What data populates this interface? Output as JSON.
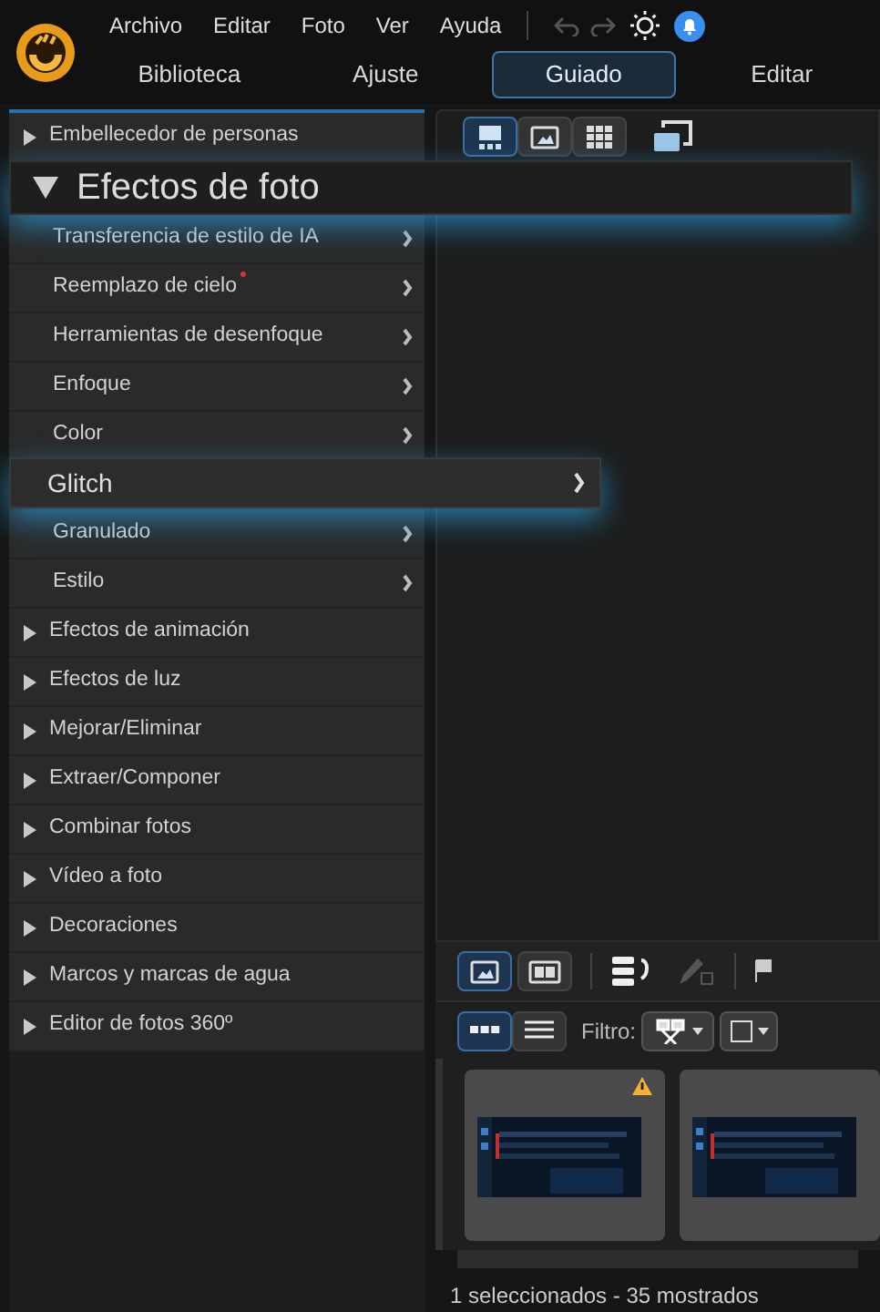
{
  "menu": [
    {
      "label": "Archivo"
    },
    {
      "label": "Editar"
    },
    {
      "label": "Foto"
    },
    {
      "label": "Ver"
    },
    {
      "label": "Ayuda"
    }
  ],
  "tabs": [
    {
      "label": "Biblioteca",
      "selected": false
    },
    {
      "label": "Ajuste",
      "selected": false
    },
    {
      "label": "Guiado",
      "selected": true
    },
    {
      "label": "Editar",
      "selected": false
    }
  ],
  "panel": {
    "items": [
      {
        "label": "Embellecedor de personas",
        "expanded": false
      },
      {
        "label": "Efectos de foto",
        "expanded": true,
        "children": [
          {
            "label": "Transferencia de estilo de IA",
            "new": false,
            "selected": false
          },
          {
            "label": "Reemplazo de cielo",
            "new": true,
            "selected": false
          },
          {
            "label": "Herramientas de desenfoque",
            "new": false,
            "selected": false
          },
          {
            "label": "Enfoque",
            "new": false,
            "selected": false
          },
          {
            "label": "Color",
            "new": false,
            "selected": false
          },
          {
            "label": "Glitch",
            "new": false,
            "selected": true
          },
          {
            "label": "Granulado",
            "new": false,
            "selected": false
          },
          {
            "label": "Estilo",
            "new": false,
            "selected": false
          }
        ]
      },
      {
        "label": "Efectos de animación",
        "expanded": false
      },
      {
        "label": "Efectos de luz",
        "expanded": false
      },
      {
        "label": "Mejorar/Eliminar",
        "expanded": false
      },
      {
        "label": "Extraer/Componer",
        "expanded": false
      },
      {
        "label": "Combinar fotos",
        "expanded": false
      },
      {
        "label": "Vídeo a foto",
        "expanded": false
      },
      {
        "label": "Decoraciones",
        "expanded": false
      },
      {
        "label": "Marcos y marcas de agua",
        "expanded": false
      },
      {
        "label": "Editor de fotos 360º",
        "expanded": false
      }
    ]
  },
  "view_buttons": [
    {
      "kind": "filmstrip",
      "selected": true
    },
    {
      "kind": "single",
      "selected": false
    },
    {
      "kind": "grid",
      "selected": false
    }
  ],
  "layout_buttons": [
    {
      "kind": "single",
      "selected": true
    },
    {
      "kind": "compare",
      "selected": false
    }
  ],
  "list_buttons": [
    {
      "kind": "thumbs",
      "selected": true
    },
    {
      "kind": "list",
      "selected": false
    }
  ],
  "filter": {
    "label": "Filtro:"
  },
  "thumbnails": [
    {
      "warning": true
    },
    {
      "warning": false
    }
  ],
  "status_bar": "1 seleccionados - 35 mostrados"
}
